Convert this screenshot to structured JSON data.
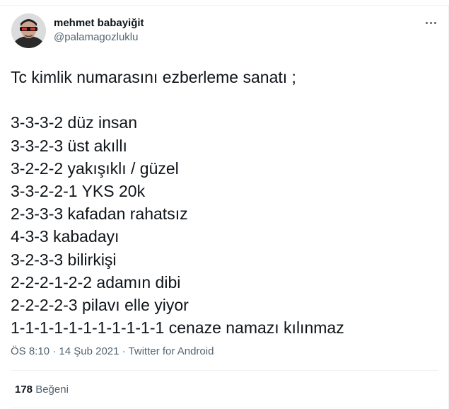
{
  "author": {
    "display_name": "mehmet babayiğit",
    "handle": "@palamagozluklu"
  },
  "tweet": {
    "intro": "Tc kimlik numarasını ezberleme sanatı ;",
    "lines": [
      "3-3-3-2 düz insan",
      "3-3-2-3 üst akıllı",
      "3-2-2-2 yakışıklı / güzel",
      "3-3-2-2-1 YKS 20k",
      "2-3-3-3 kafadan rahatsız",
      "4-3-3 kabadayı",
      "3-2-3-3 bilirkişi",
      "2-2-2-1-2-2 adamın dibi",
      "2-2-2-2-3 pilavı elle yiyor",
      "1-1-1-1-1-1-1-1-1-1-1 cenaze namazı kılınmaz"
    ]
  },
  "meta": {
    "time": "ÖS 8:10",
    "separator1": " · ",
    "date": "14 Şub 2021",
    "separator2": " · ",
    "source": "Twitter for Android"
  },
  "stats": {
    "likes_count": "178",
    "likes_label": "Beğeni"
  },
  "icons": {
    "more": "more-horizontal-icon"
  }
}
